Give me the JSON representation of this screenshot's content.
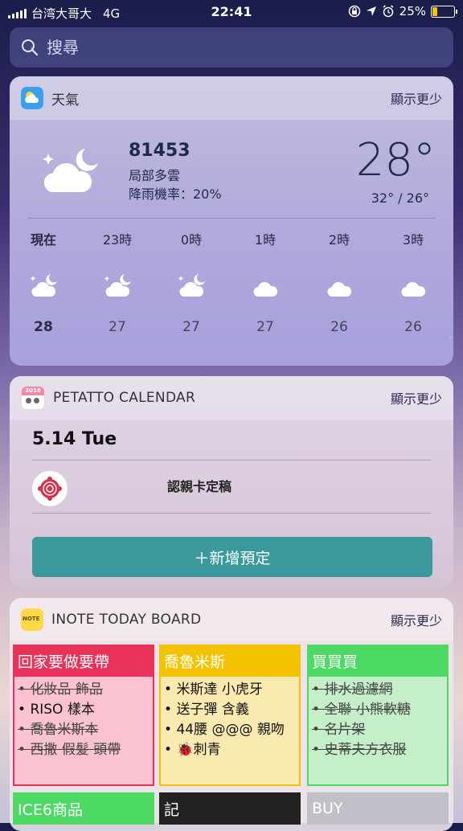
{
  "status_bar": {
    "carrier": "台湾大哥大",
    "network": "4G",
    "time": "22:41",
    "battery": "25%",
    "battery_level": 0.25
  },
  "search": {
    "placeholder": "搜尋"
  },
  "weather_widget": {
    "app_name": "天氣",
    "toggle": "顯示更少",
    "location": "81453",
    "condition": "局部多雲",
    "rain_chance": "降雨機率：20%",
    "temperature": "28°",
    "range": "32° / 26°",
    "hourly": [
      {
        "label": "現在",
        "icon": "partly-cloudy-night-icon",
        "temp": "28"
      },
      {
        "label": "23時",
        "icon": "partly-cloudy-night-icon",
        "temp": "27"
      },
      {
        "label": "0時",
        "icon": "partly-cloudy-night-icon",
        "temp": "27"
      },
      {
        "label": "1時",
        "icon": "cloud-icon",
        "temp": "27"
      },
      {
        "label": "2時",
        "icon": "cloud-icon",
        "temp": "26"
      },
      {
        "label": "3時",
        "icon": "cloud-icon",
        "temp": "26"
      }
    ]
  },
  "calendar_widget": {
    "app_name": "PETATTO CALENDAR",
    "icon_text": "2018",
    "toggle": "顯示更少",
    "date": "5.14 Tue",
    "event_title": "認親卡定稿",
    "add_button": "＋新增預定"
  },
  "inote_widget": {
    "app_name": "INOTE TODAY BOARD",
    "icon_text": "NOTE",
    "toggle": "顯示更少",
    "boards": [
      {
        "title": "回家要做要帶",
        "color": "#e8325a",
        "body_color": "#fbc3cf",
        "items": [
          {
            "text": "化妝品 飾品",
            "done": true
          },
          {
            "text": "RISO 樣本",
            "done": false
          },
          {
            "text": "喬魯米斯本",
            "done": true
          },
          {
            "text": "西撒 假髮 頭帶",
            "done": true
          }
        ]
      },
      {
        "title": "喬魯米斯",
        "color": "#f4c300",
        "body_color": "#fbeab0",
        "items": [
          {
            "text": "米斯達 小虎牙",
            "done": false
          },
          {
            "text": "送子彈 含義",
            "done": false
          },
          {
            "text": "44腰 @@@ 親吻",
            "done": false
          },
          {
            "text": "🐞刺青",
            "done": false
          }
        ]
      },
      {
        "title": "買買買",
        "color": "#4cd964",
        "body_color": "#c5efc9",
        "items": [
          {
            "text": "排水過濾網",
            "done": true
          },
          {
            "text": "全聯 小熊軟糖",
            "done": true
          },
          {
            "text": "名片架",
            "done": true
          },
          {
            "text": "史蒂夫方衣服",
            "done": true
          }
        ]
      }
    ],
    "boards_row2": [
      {
        "title": "ICE6商品",
        "color": "#4cd964"
      },
      {
        "title": "記",
        "color": "#222222"
      },
      {
        "title": "BUY",
        "color": "#c0c0c8"
      }
    ]
  }
}
